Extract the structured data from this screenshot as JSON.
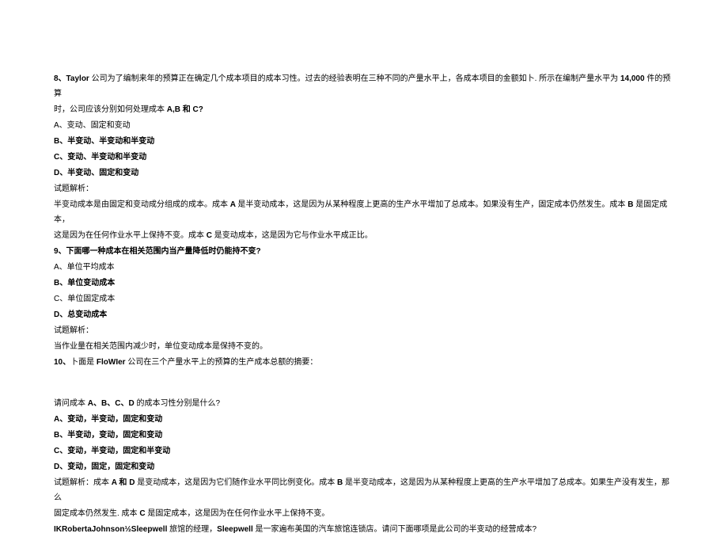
{
  "q8": {
    "header_prefix": "8、Taylor ",
    "header_text": "公司为了编制来年的预算正在确定几个成本项目的成本习性。过去的经验表明在三种不同的产量水平上，各成本项目的金额如卜. 所示在编制产量水平为 ",
    "header_num": "14,000 ",
    "header_suffix": "件的预算",
    "line2_prefix": "时，公司应该分别如何处理成本 ",
    "line2_bold": "A,B 和 C?",
    "optA": "A、变动、固定和变动",
    "optB": "B、半变动、半变动和半变动",
    "optC": "C、变动、半变动和半变动",
    "optD": "D、半变动、固定和变动",
    "analysis_label": "试题解析：",
    "analysis_p1_a": "半变动成本是由固定和变动成分组成的成本。成本 ",
    "analysis_p1_b": "A ",
    "analysis_p1_c": "是半变动成本，这是因为从某种程度上更高的生产水平增加了总成本。如果没有生产，固定成本仍然发生。成本 ",
    "analysis_p1_d": "B ",
    "analysis_p1_e": "是固定成本，",
    "analysis_p2_a": "这是因为在任何作业水平上保持不变。成本 ",
    "analysis_p2_b": "C ",
    "analysis_p2_c": "是变动成本，这是因为它与作业水平成正比。"
  },
  "q9": {
    "header": "9、下面哪一种成本在相关范围内当产量降低时仍能持不变?",
    "optA": "A、单位平均成本",
    "optB": "B、单位变动成本",
    "optC": "C、单位固定成本",
    "optD": "D、总变动成本",
    "analysis_label": "试题解析：",
    "analysis_text": "当作业量在相关范围内减少时，单位变动成本是保持不变的。"
  },
  "q10": {
    "header_prefix": "10、",
    "header_mid": "卜面是 ",
    "header_bold": "FloWIer ",
    "header_suffix": "公司在三个产量水平上的预算的生产成本总额的摘要：",
    "question_a": "请问成本 ",
    "question_b": "A、B、C、D ",
    "question_c": "的成本习性分别是什么?",
    "optA": "A、变动，半变动，固定和变动",
    "optB": "B、半变动，变动，固定和变动",
    "optC": "C、变动，半变动，固定和半变动",
    "optD": "D、变动，固定，固定和变动",
    "analysis_p1_a": "试题解析：成本 ",
    "analysis_p1_b": "A 和 D ",
    "analysis_p1_c": "是变动成本，这是因为它们随作业水平同比例变化。成本 ",
    "analysis_p1_d": "B ",
    "analysis_p1_e": "是半变动成本，这是因为从某种程度上更高的生产水平增加了总成本。如果生产没有发生，那么",
    "analysis_p2_a": "固定成本仍然发生. 成本 ",
    "analysis_p2_b": "C ",
    "analysis_p2_c": "是固定成本，这是因为在任何作业水平上保持不变。"
  },
  "q11": {
    "bold_prefix": "IKRobertaJohnson½Sleepwell ",
    "text_a": "旅馆的经理，",
    "bold_mid": "Sleepwell ",
    "text_b": "是一家遍布美国的汽车旅馆连锁店。请问下面哪项是此公司的半变动的经营成本?"
  }
}
